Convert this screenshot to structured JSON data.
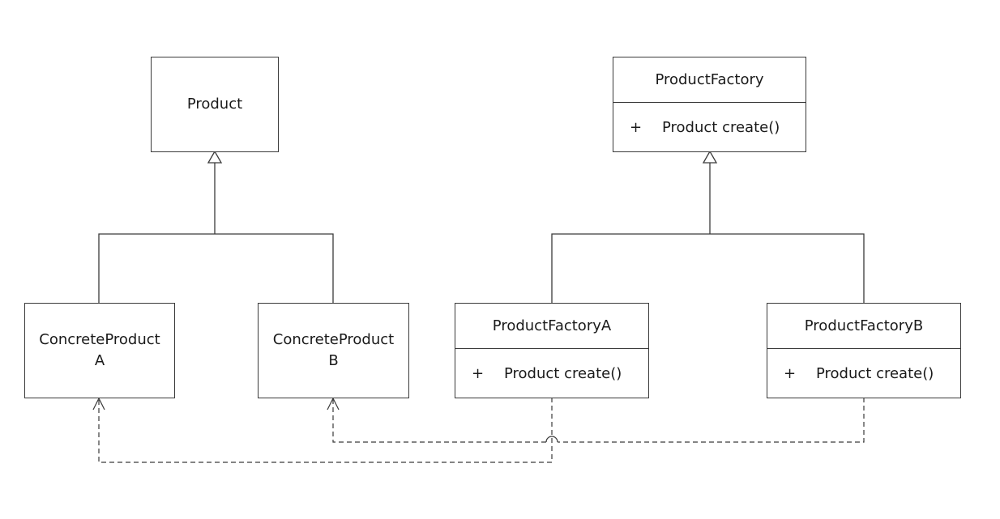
{
  "diagram": {
    "type": "UML class diagram",
    "classes": {
      "product": {
        "name": "Product"
      },
      "concrete_a": {
        "name_line1": "ConcreteProduct",
        "name_line2": "A"
      },
      "concrete_b": {
        "name_line1": "ConcreteProduct",
        "name_line2": "B"
      },
      "factory": {
        "name": "ProductFactory",
        "op_visibility": "+",
        "op_signature": "Product create()"
      },
      "factory_a": {
        "name": "ProductFactoryA",
        "op_visibility": "+",
        "op_signature": "Product create()"
      },
      "factory_b": {
        "name": "ProductFactoryB",
        "op_visibility": "+",
        "op_signature": "Product create()"
      }
    },
    "relationships": [
      {
        "kind": "generalization",
        "from": "ConcreteProductA",
        "to": "Product"
      },
      {
        "kind": "generalization",
        "from": "ConcreteProductB",
        "to": "Product"
      },
      {
        "kind": "generalization",
        "from": "ProductFactoryA",
        "to": "ProductFactory"
      },
      {
        "kind": "generalization",
        "from": "ProductFactoryB",
        "to": "ProductFactory"
      },
      {
        "kind": "dependency",
        "from": "ProductFactoryA",
        "to": "ConcreteProductA"
      },
      {
        "kind": "dependency",
        "from": "ProductFactoryB",
        "to": "ConcreteProductB"
      }
    ],
    "colors": {
      "line": "#3a3a3a",
      "text": "#1a1a1a",
      "background": "#ffffff"
    }
  }
}
